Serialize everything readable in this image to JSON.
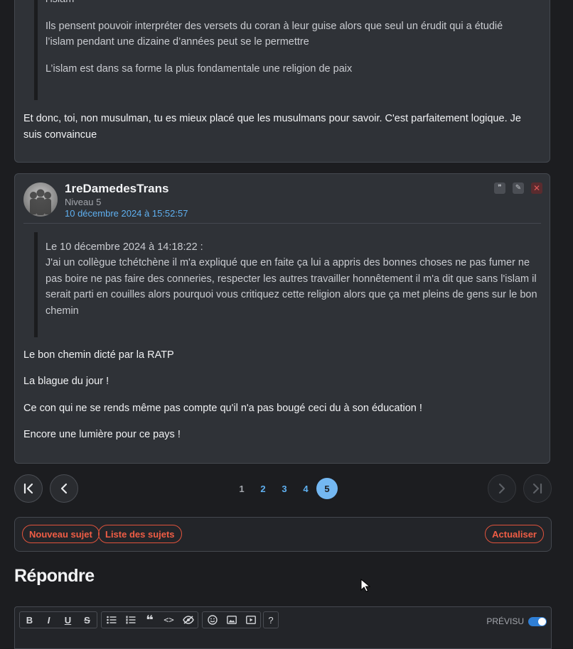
{
  "prev_post": {
    "quote_lines": [
      "l’islam",
      "Ils pensent pouvoir interpréter des versets du coran à leur guise alors que seul un érudit qui a étudié l’islam pendant une dizaine d’années peut se le permettre",
      "L’islam est dans sa forme la plus fondamentale une religion de paix"
    ],
    "body": "Et donc, toi, non musulman, tu es mieux placé que les musulmans pour savoir. C'est parfaitement logique. Je suis convaincue"
  },
  "post": {
    "author": "1reDamedesTrans",
    "level": "Niveau 5",
    "date": "10 décembre 2024 à 15:52:57",
    "actions": {
      "quote_icon": "quote-icon",
      "edit_icon": "pencil-icon",
      "delete_icon": "close-icon"
    },
    "quote_header": "Le 10 décembre 2024 à 14:18:22 :",
    "quote_text": "J'ai un collègue tchétchène il m'a expliqué que en faite ça lui a appris des bonnes choses ne pas fumer ne pas boire ne pas faire des conneries, respecter les autres travailler honnêtement il m'a dit que sans l'islam il serait parti en couilles alors pourquoi vous critiquez cette religion alors que ça met pleins de gens sur le bon chemin",
    "paragraphs": [
      "Le bon chemin dicté par la RATP",
      "La blague du jour !",
      "Ce con qui ne se rends même pas compte qu'il n'a pas bougé ceci du à son éducation !",
      "Encore une lumière pour ce pays !"
    ]
  },
  "pagination": {
    "pages": [
      "1",
      "2",
      "3",
      "4",
      "5"
    ],
    "current": "5",
    "first_icon": "first-page-icon",
    "prev_icon": "chevron-left-icon",
    "next_icon": "chevron-right-icon",
    "last_icon": "last-page-icon"
  },
  "actions_bar": {
    "new_topic": "Nouveau sujet",
    "topic_list": "Liste des sujets",
    "refresh": "Actualiser"
  },
  "reply": {
    "title": "Répondre",
    "preview_label": "PRÉVISU",
    "preview_on": true,
    "toolbar": {
      "bold": "B",
      "italic": "I",
      "underline": "U",
      "strike": "S",
      "help": "?"
    }
  },
  "colors": {
    "accent_blue": "#5fb0f0",
    "action_red": "#f05d45",
    "toggle_blue": "#2f7fd6"
  }
}
